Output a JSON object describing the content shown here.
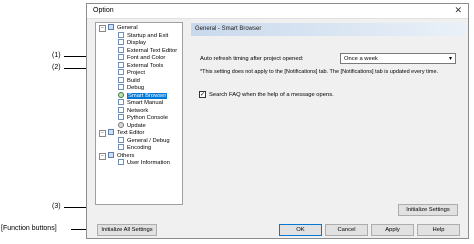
{
  "window": {
    "title": "Option",
    "close_glyph": "✕"
  },
  "tree": [
    {
      "label": "General",
      "icon": "folder-icon",
      "expander": "−"
    },
    {
      "label": "Startup and Exit",
      "icon": "page-icon"
    },
    {
      "label": "Display",
      "icon": "page-icon"
    },
    {
      "label": "External Text Editor",
      "icon": "page-icon"
    },
    {
      "label": "Font and Color",
      "icon": "page-icon"
    },
    {
      "label": "External Tools",
      "icon": "page-icon"
    },
    {
      "label": "Project",
      "icon": "page-icon"
    },
    {
      "label": "Build",
      "icon": "page-icon"
    },
    {
      "label": "Debug",
      "icon": "page-icon"
    },
    {
      "label": "Smart Browser",
      "icon": "globe-icon",
      "selected": true
    },
    {
      "label": "Smart Manual",
      "icon": "page-icon"
    },
    {
      "label": "Network",
      "icon": "page-icon"
    },
    {
      "label": "Python Console",
      "icon": "page-icon"
    },
    {
      "label": "Update",
      "icon": "gear-icon"
    },
    {
      "label": "Text Editor",
      "icon": "folder-icon",
      "expander": "−"
    },
    {
      "label": "General / Debug",
      "icon": "page-icon"
    },
    {
      "label": "Encoding",
      "icon": "page-icon"
    },
    {
      "label": "Others",
      "icon": "folder-icon",
      "expander": "−"
    },
    {
      "label": "User Information",
      "icon": "page-icon"
    }
  ],
  "panel": {
    "title": "General - Smart Browser",
    "auto_refresh_label": "Auto refresh timing after project opened:",
    "auto_refresh_value": "Once a week",
    "note": "*This setting does not apply to the [Notifications] tab. The [Notifications] tab is updated every time.",
    "search_faq_label": "Search FAQ when the help of a message opens.",
    "search_faq_checked": true,
    "check_glyph": "✓",
    "dropdown_arrow": "▾",
    "initialize_settings_label": "Initialize Settings"
  },
  "footer": {
    "initialize_all_label": "Initialize All Settings",
    "ok_label": "OK",
    "cancel_label": "Cancel",
    "apply_label": "Apply",
    "help_label": "Help"
  },
  "callouts": {
    "c1": "(1)",
    "c2": "(2)",
    "c3": "(3)",
    "function_buttons": "[Function buttons]"
  }
}
